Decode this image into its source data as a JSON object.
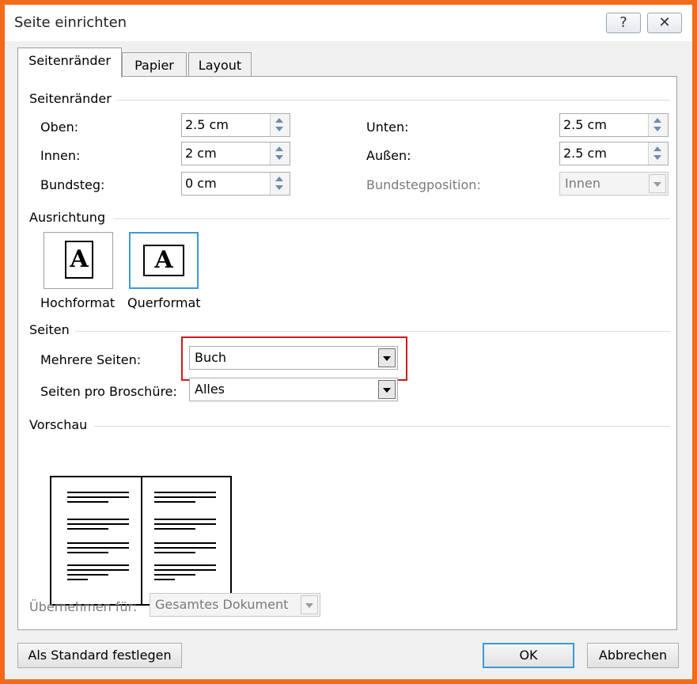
{
  "window": {
    "title": "Seite einrichten",
    "help": "?",
    "close": "✕"
  },
  "tabs": [
    {
      "label": "Seitenränder"
    },
    {
      "label": "Papier"
    },
    {
      "label": "Layout"
    }
  ],
  "margins": {
    "heading": "Seitenränder",
    "oben": {
      "label": "Oben:",
      "value": "2.5 cm"
    },
    "unten": {
      "label": "Unten:",
      "value": "2.5 cm"
    },
    "innen": {
      "label": "Innen:",
      "value": "2 cm"
    },
    "aussen": {
      "label": "Außen:",
      "value": "2.5 cm"
    },
    "bundsteg": {
      "label": "Bundsteg:",
      "value": "0 cm"
    },
    "bundstegposition": {
      "label": "Bundstegposition:",
      "value": "Innen"
    }
  },
  "orientation": {
    "heading": "Ausrichtung",
    "portrait": {
      "label": "Hochformat",
      "glyph": "A",
      "icon": "portrait-page-icon"
    },
    "landscape": {
      "label": "Querformat",
      "glyph": "A",
      "icon": "landscape-page-icon",
      "selected": true
    }
  },
  "pages": {
    "heading": "Seiten",
    "multiple": {
      "label": "Mehrere Seiten:",
      "value": "Buch"
    },
    "per_booklet": {
      "label": "Seiten pro Broschüre:",
      "value": "Alles"
    }
  },
  "preview": {
    "heading": "Vorschau"
  },
  "apply_to": {
    "label": "Übernehmen für:",
    "value": "Gesamtes Dokument"
  },
  "buttons": {
    "set_default": "Als Standard festlegen",
    "ok": "OK",
    "cancel": "Abbrechen"
  },
  "colors": {
    "frame": "#f26b1d",
    "highlight": "#d11a1a",
    "accent": "#3c9ad8",
    "dialog_bg": "#f0f0f0"
  }
}
